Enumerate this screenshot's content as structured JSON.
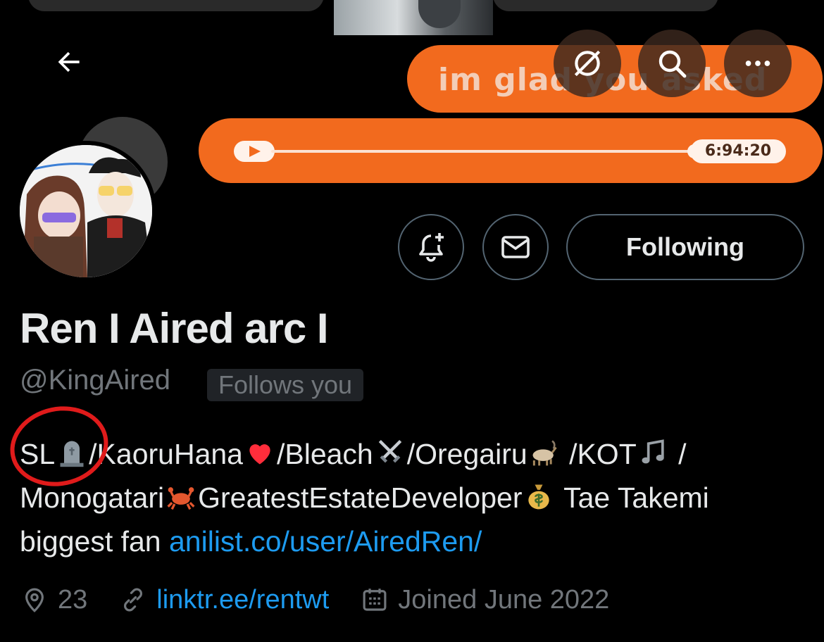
{
  "banner": {
    "message": "im glad you asked",
    "audio_time": "6:94:20"
  },
  "profile": {
    "display_name": "Ren I Aired arc I",
    "handle": "@KingAired",
    "follows_badge": "Follows you",
    "follow_label": "Following",
    "bio": {
      "line1": [
        "SL",
        "/KaoruHana",
        "/Bleach",
        "/Oregairu",
        " /KOT",
        " /"
      ],
      "line2": [
        "Monogatari",
        "GreatestEstateDeveloper",
        " Tae Takemi"
      ],
      "line3_text": "biggest fan ",
      "line3_link": "anilist.co/user/AiredRen/"
    },
    "location": "23",
    "website": "linktr.ee/rentwt",
    "joined": "Joined June 2022"
  },
  "colors": {
    "background": "#000000",
    "text": "#e7e9ea",
    "muted": "#71767b",
    "link": "#1d9bf0",
    "banner_orange": "#f26a1e",
    "annotation_red": "#e01b1b"
  },
  "icons": {
    "back": "arrow-left-icon",
    "grok": "grok-icon",
    "search": "search-icon",
    "more": "more-icon",
    "notify": "bell-plus-icon",
    "message": "mail-icon",
    "location": "location-pin-icon",
    "link": "link-icon",
    "calendar": "calendar-icon"
  }
}
